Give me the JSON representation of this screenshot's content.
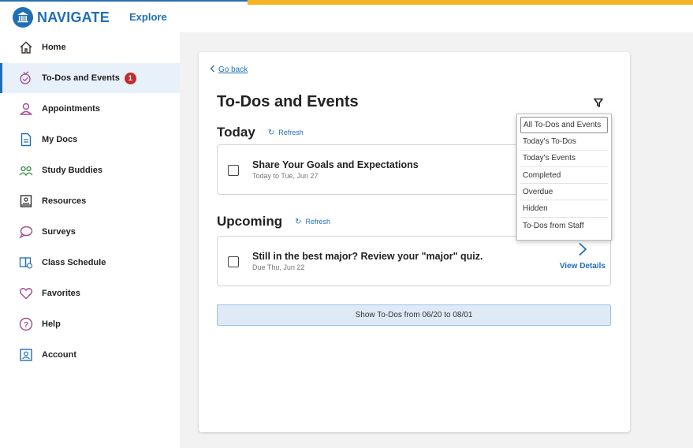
{
  "header": {
    "logo_text": "NAVIGATE",
    "explore_label": "Explore",
    "accent_color": "#f4b324",
    "brand_color": "#1f6fb8"
  },
  "sidebar": {
    "items": [
      {
        "label": "Home",
        "icon": "home-icon"
      },
      {
        "label": "To-Dos and Events",
        "icon": "todo-icon",
        "badge": "1",
        "active": true
      },
      {
        "label": "Appointments",
        "icon": "person-icon"
      },
      {
        "label": "My Docs",
        "icon": "document-icon"
      },
      {
        "label": "Study Buddies",
        "icon": "people-icon"
      },
      {
        "label": "Resources",
        "icon": "resources-icon"
      },
      {
        "label": "Surveys",
        "icon": "chat-bubble-icon"
      },
      {
        "label": "Class Schedule",
        "icon": "schedule-icon"
      },
      {
        "label": "Favorites",
        "icon": "heart-icon"
      },
      {
        "label": "Help",
        "icon": "help-icon"
      },
      {
        "label": "Account",
        "icon": "account-icon"
      }
    ]
  },
  "main": {
    "go_back": "Go back",
    "title": "To-Dos and Events",
    "today": {
      "heading": "Today",
      "refresh": "Refresh",
      "items": [
        {
          "title": "Share Your Goals and Expectations",
          "subtitle": "Today to Tue, Jun 27"
        }
      ]
    },
    "upcoming": {
      "heading": "Upcoming",
      "refresh": "Refresh",
      "items": [
        {
          "title": "Still in the best major? Review your \"major\" quiz.",
          "subtitle": "Due Thu, Jun 22",
          "action": "View Details"
        }
      ]
    },
    "show_button": "Show To-Dos from 06/20 to 08/01"
  },
  "filter_menu": {
    "selected": "All To-Dos and Events",
    "options": [
      "All To-Dos and Events",
      "Today's To-Dos",
      "Today's Events",
      "Completed",
      "Overdue",
      "Hidden",
      "To-Dos from Staff"
    ]
  }
}
